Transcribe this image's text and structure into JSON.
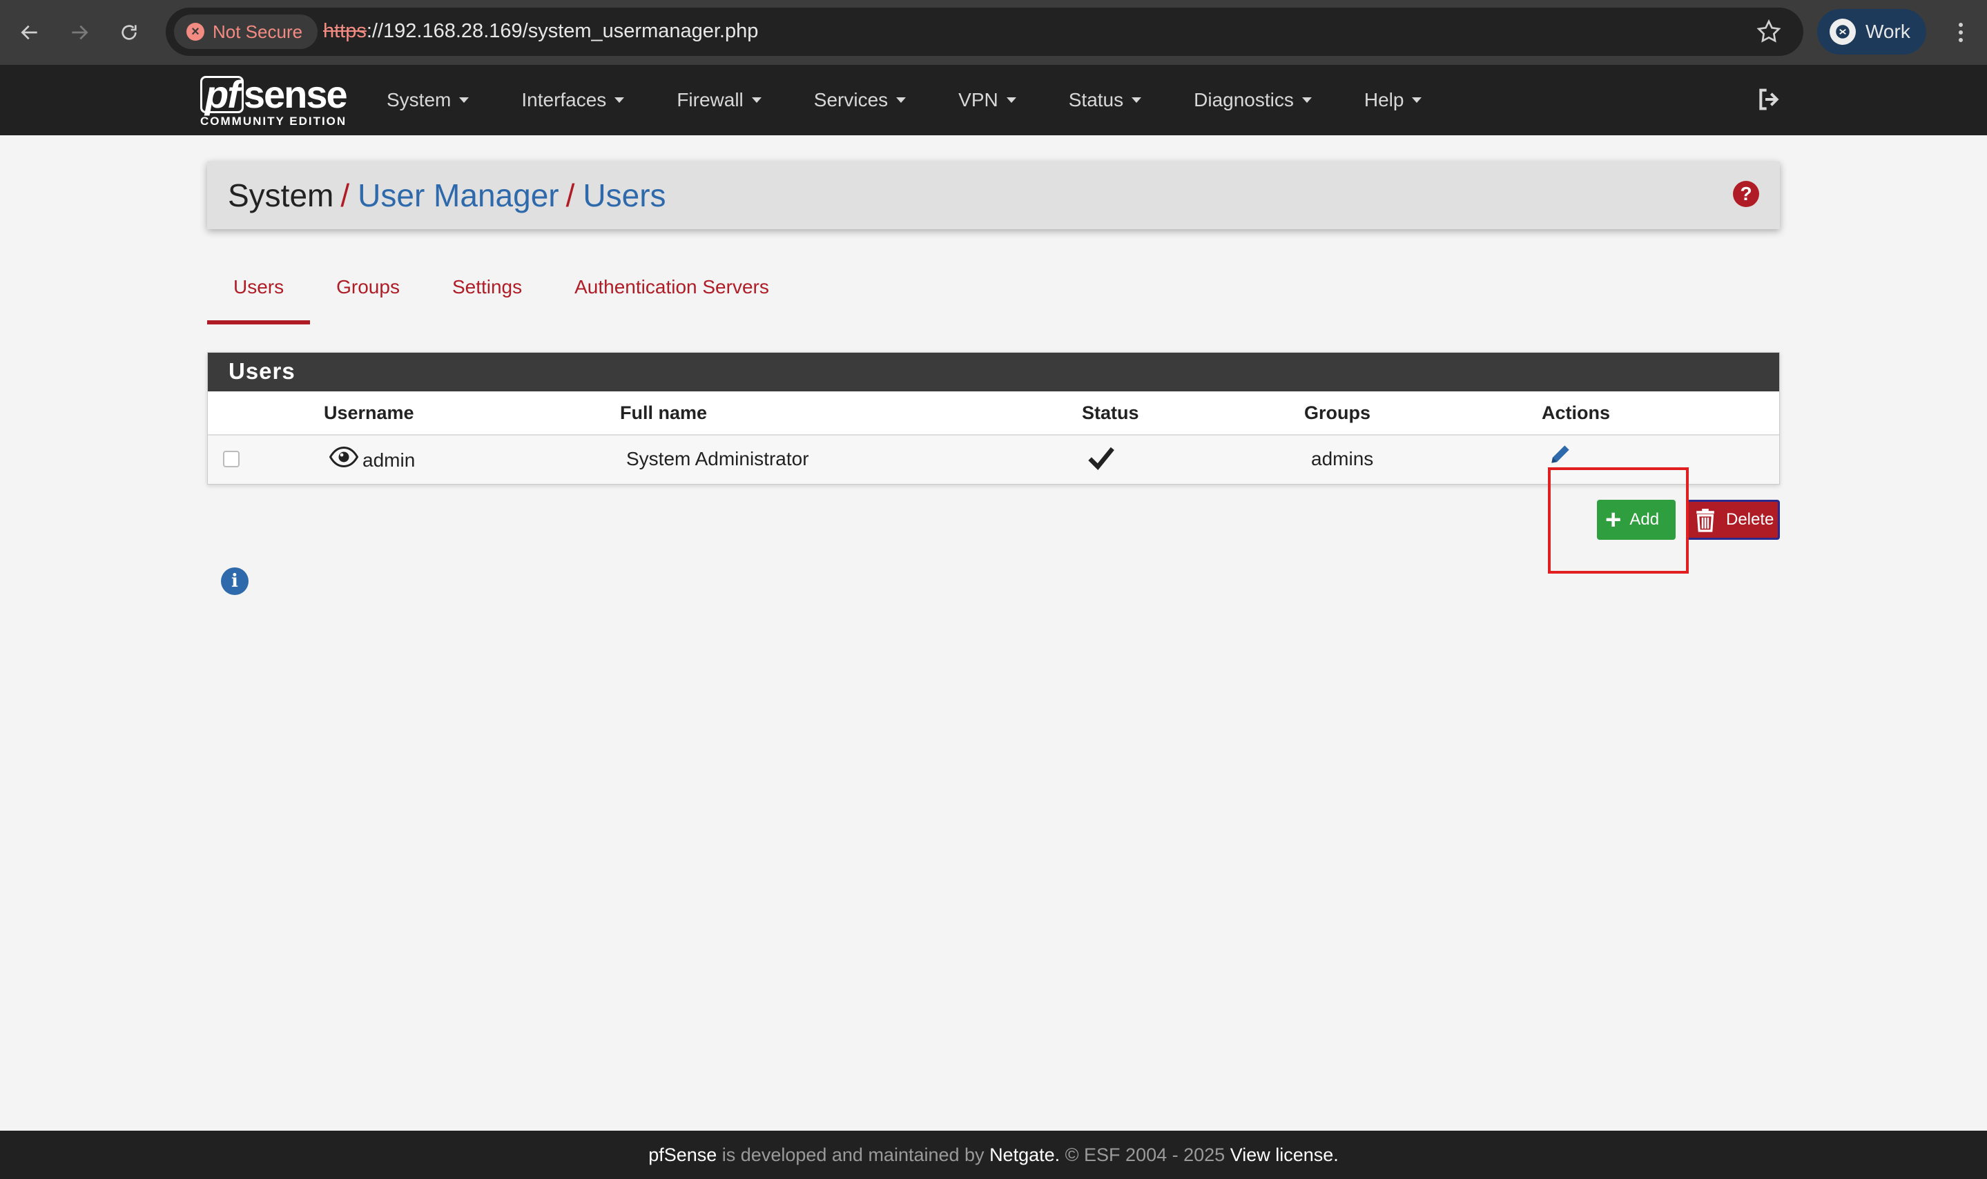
{
  "browser": {
    "security_label": "Not Secure",
    "url_scheme": "https",
    "url_rest": "://192.168.28.169/system_usermanager.php",
    "profile_name": "Work"
  },
  "navbar": {
    "logo_main": "sense",
    "logo_pf": "pf",
    "logo_sub": "COMMUNITY EDITION",
    "menu": [
      "System",
      "Interfaces",
      "Firewall",
      "Services",
      "VPN",
      "Status",
      "Diagnostics",
      "Help"
    ]
  },
  "breadcrumb": {
    "items": [
      "System",
      "User Manager",
      "Users"
    ],
    "separator": "/"
  },
  "tabs": [
    "Users",
    "Groups",
    "Settings",
    "Authentication Servers"
  ],
  "users_panel": {
    "heading": "Users",
    "columns": [
      "Username",
      "Full name",
      "Status",
      "Groups",
      "Actions"
    ],
    "rows": [
      {
        "username": "admin",
        "full_name": "System Administrator",
        "groups": "admins"
      }
    ]
  },
  "buttons": {
    "add": "Add",
    "delete": "Delete"
  },
  "footer": {
    "brand": "pfSense",
    "text1": " is developed and maintained by ",
    "company": "Netgate.",
    "text2": " © ESF 2004 - 2025 ",
    "license": "View license."
  },
  "colors": {
    "accent_red": "#b01c26",
    "link_blue": "#2e6aab",
    "add_green": "#2e9e3f",
    "navbar_bg": "#212121"
  }
}
